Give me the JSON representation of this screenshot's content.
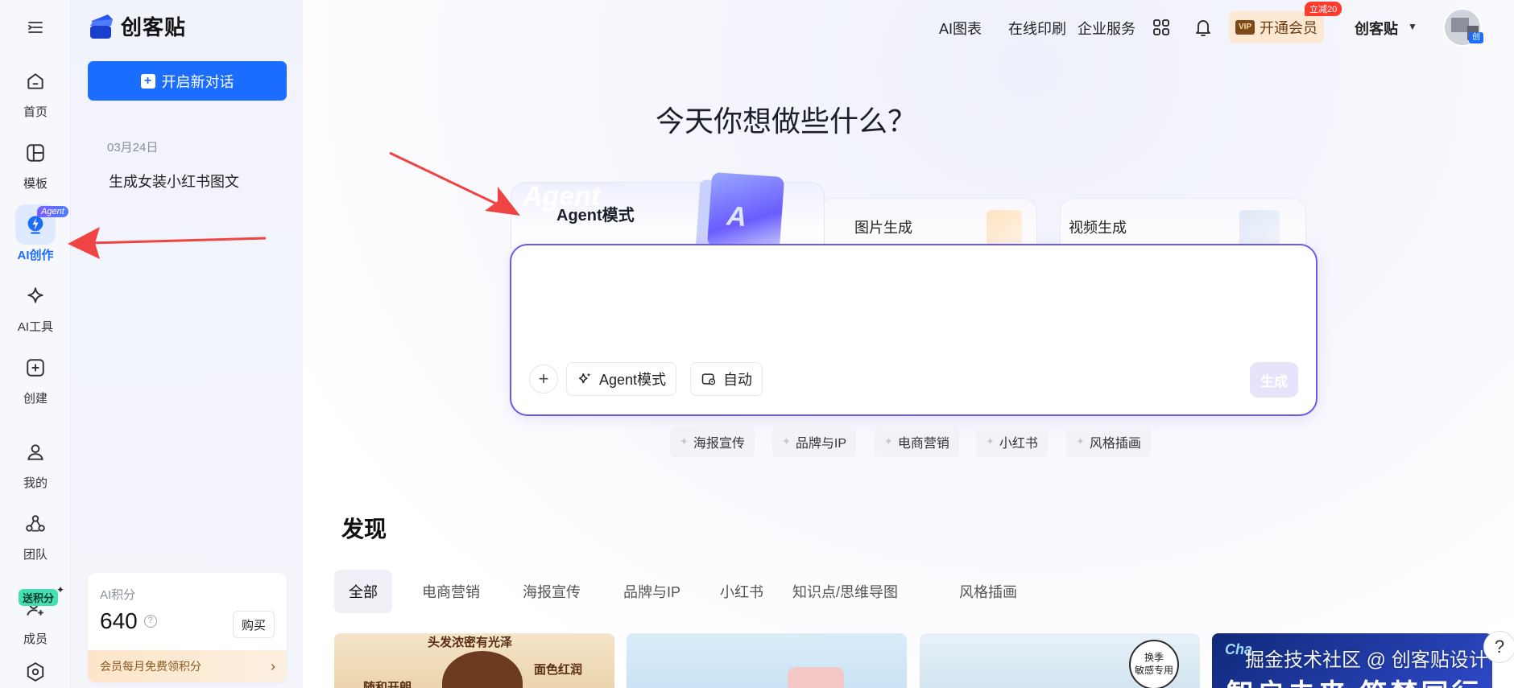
{
  "brand": {
    "name": "创客贴"
  },
  "rail": {
    "items": [
      {
        "label": "首页",
        "icon": "home-icon"
      },
      {
        "label": "模板",
        "icon": "template-icon"
      },
      {
        "label": "AI创作",
        "icon": "ai-create-icon",
        "badge": "Agent",
        "active": true
      },
      {
        "label": "AI工具",
        "icon": "sparkle-icon"
      },
      {
        "label": "创建",
        "icon": "plus-square-icon"
      },
      {
        "label": "我的",
        "icon": "user-icon"
      },
      {
        "label": "团队",
        "icon": "team-icon"
      },
      {
        "label": "成员",
        "icon": "add-member-icon",
        "badge": "送积分"
      }
    ]
  },
  "sidebar": {
    "new_chat_label": "开启新对话",
    "history": [
      {
        "date": "03月24日",
        "items": [
          "生成女装小红书图文"
        ]
      }
    ],
    "points": {
      "title": "AI积分",
      "value": "640",
      "buy_label": "购买",
      "promo": "会员每月免费领积分"
    }
  },
  "topnav": {
    "links": [
      "AI图表",
      "在线印刷",
      "企业服务"
    ],
    "vip_label": "开通会员",
    "vip_tag": "VIP",
    "vip_discount": "立减20",
    "user_name": "创客贴",
    "avatar_tag": "创"
  },
  "hero": {
    "title": "今天你想做些什么？"
  },
  "modes": {
    "agent": {
      "label": "Agent模式",
      "ghost": "Agent",
      "art": "A"
    },
    "image": {
      "label": "图片生成"
    },
    "video": {
      "label": "视频生成"
    }
  },
  "prompt": {
    "value": "",
    "placeholder": "",
    "chip_agent": "Agent模式",
    "chip_auto": "自动",
    "generate": "生成"
  },
  "quick_tags": [
    "海报宣传",
    "品牌与IP",
    "电商营销",
    "小红书",
    "风格插画"
  ],
  "discover": {
    "title": "发现",
    "filters": [
      "全部",
      "电商营销",
      "海报宣传",
      "品牌与IP",
      "小红书",
      "知识点/思维导图",
      "风格插画"
    ],
    "cards": {
      "c1": {
        "t1": "头发浓密有光泽",
        "t2": "面色红润",
        "t3": "随和开朗"
      },
      "c3": {
        "stamp": "换季\n敏感专用"
      },
      "c4": {
        "top": "Cha",
        "big": "智启未来 筑梦同行"
      }
    }
  },
  "watermark": "掘金技术社区 @ 创客贴设计",
  "help": "?",
  "colors": {
    "accent": "#1a6dff",
    "prompt_border": "#6a5ce8",
    "annotation": "#f04343"
  }
}
